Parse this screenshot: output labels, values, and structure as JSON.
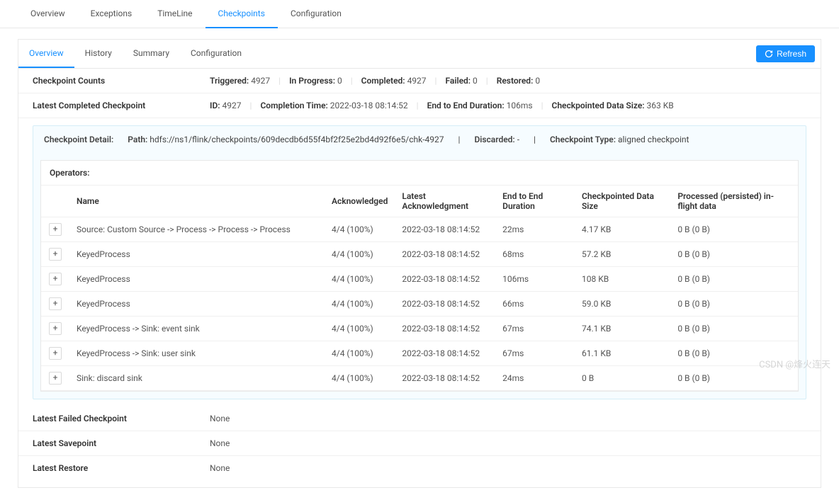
{
  "outer_tabs": [
    "Overview",
    "Exceptions",
    "TimeLine",
    "Checkpoints",
    "Configuration"
  ],
  "outer_active": 3,
  "inner_tabs": [
    "Overview",
    "History",
    "Summary",
    "Configuration"
  ],
  "inner_active": 0,
  "refresh_label": "Refresh",
  "checkpoint_counts": {
    "title": "Checkpoint Counts",
    "triggered_label": "Triggered:",
    "triggered": "4927",
    "inprogress_label": "In Progress:",
    "inprogress": "0",
    "completed_label": "Completed:",
    "completed": "4927",
    "failed_label": "Failed:",
    "failed": "0",
    "restored_label": "Restored:",
    "restored": "0"
  },
  "latest_completed": {
    "title": "Latest Completed Checkpoint",
    "id_label": "ID:",
    "id": "4927",
    "completion_time_label": "Completion Time:",
    "completion_time": "2022-03-18 08:14:52",
    "e2e_label": "End to End Duration:",
    "e2e": "106ms",
    "size_label": "Checkpointed Data Size:",
    "size": "363 KB"
  },
  "detail": {
    "title": "Checkpoint Detail:",
    "path_label": "Path:",
    "path": "hdfs://ns1/flink/checkpoints/609decdb6d55f4bf2f25e2bd4d92f6e5/chk-4927",
    "discarded_label": "Discarded:",
    "discarded": "-",
    "type_label": "Checkpoint Type:",
    "type": "aligned checkpoint"
  },
  "operators": {
    "title": "Operators:",
    "columns": [
      "",
      "Name",
      "Acknowledged",
      "Latest Acknowledgment",
      "End to End Duration",
      "Checkpointed Data Size",
      "Processed (persisted) in-flight data"
    ],
    "rows": [
      {
        "name": "Source: Custom Source -> Process -> Process -> Process",
        "ack": "4/4 (100%)",
        "latest": "2022-03-18 08:14:52",
        "dur": "22ms",
        "size": "4.17 KB",
        "inflight": "0 B (0 B)"
      },
      {
        "name": "KeyedProcess",
        "ack": "4/4 (100%)",
        "latest": "2022-03-18 08:14:52",
        "dur": "68ms",
        "size": "57.2 KB",
        "inflight": "0 B (0 B)"
      },
      {
        "name": "KeyedProcess",
        "ack": "4/4 (100%)",
        "latest": "2022-03-18 08:14:52",
        "dur": "106ms",
        "size": "108 KB",
        "inflight": "0 B (0 B)"
      },
      {
        "name": "KeyedProcess",
        "ack": "4/4 (100%)",
        "latest": "2022-03-18 08:14:52",
        "dur": "66ms",
        "size": "59.0 KB",
        "inflight": "0 B (0 B)"
      },
      {
        "name": "KeyedProcess -> Sink: event sink",
        "ack": "4/4 (100%)",
        "latest": "2022-03-18 08:14:52",
        "dur": "67ms",
        "size": "74.1 KB",
        "inflight": "0 B (0 B)"
      },
      {
        "name": "KeyedProcess -> Sink: user sink",
        "ack": "4/4 (100%)",
        "latest": "2022-03-18 08:14:52",
        "dur": "67ms",
        "size": "61.1 KB",
        "inflight": "0 B (0 B)"
      },
      {
        "name": "Sink: discard sink",
        "ack": "4/4 (100%)",
        "latest": "2022-03-18 08:14:52",
        "dur": "24ms",
        "size": "0 B",
        "inflight": "0 B (0 B)"
      }
    ]
  },
  "footer_rows": [
    {
      "label": "Latest Failed Checkpoint",
      "value": "None"
    },
    {
      "label": "Latest Savepoint",
      "value": "None"
    },
    {
      "label": "Latest Restore",
      "value": "None"
    }
  ],
  "watermark": "CSDN @烽火连天"
}
